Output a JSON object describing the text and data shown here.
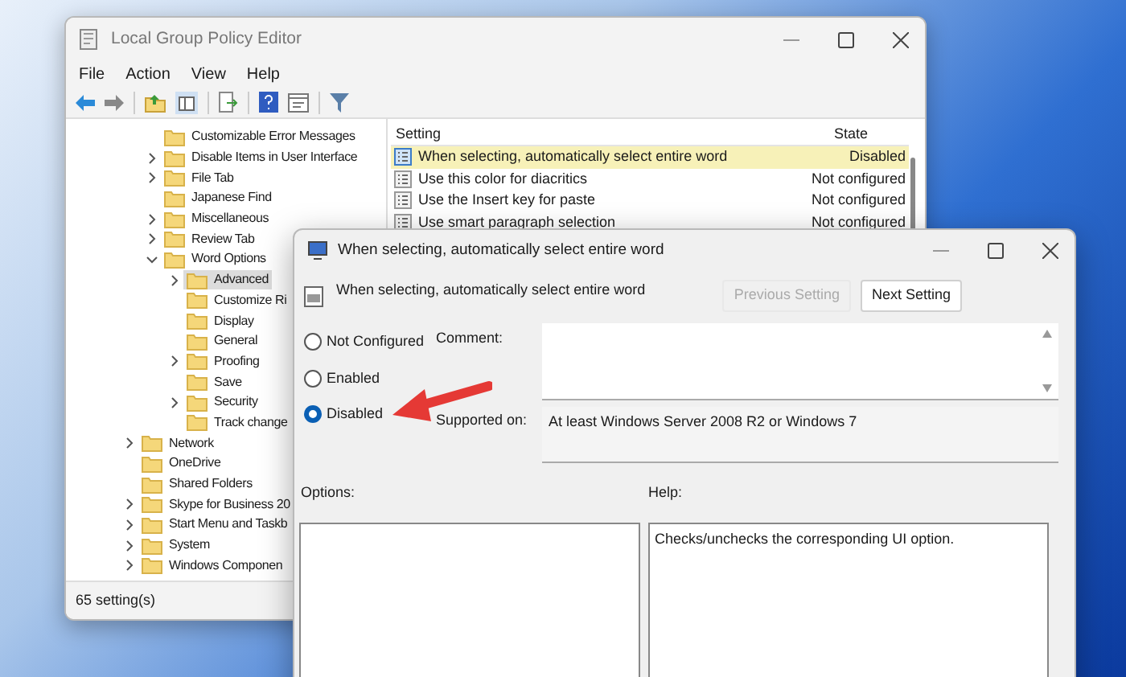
{
  "main_window": {
    "title": "Local Group Policy Editor",
    "menu": [
      "File",
      "Action",
      "View",
      "Help"
    ],
    "tree": [
      {
        "children": [
          {
            "label": "Customizable Error Messages",
            "expandable": false,
            "selected": false
          },
          {
            "label": "Disable Items in User Interface",
            "expandable": true,
            "selected": false
          },
          {
            "label": "File Tab",
            "expandable": true,
            "selected": false
          },
          {
            "label": "Japanese Find",
            "expandable": false,
            "selected": false
          },
          {
            "label": "Miscellaneous",
            "expandable": true,
            "selected": false
          },
          {
            "label": "Review Tab",
            "expandable": true,
            "selected": false
          },
          {
            "label": "Word Options",
            "expandable": true,
            "expanded": true,
            "selected": false,
            "children": [
              {
                "label": "Advanced",
                "expandable": true,
                "selected": true
              },
              {
                "label": "Customize Ri",
                "expandable": false,
                "selected": false
              },
              {
                "label": "Display",
                "expandable": false,
                "selected": false
              },
              {
                "label": "General",
                "expandable": false,
                "selected": false
              },
              {
                "label": "Proofing",
                "expandable": true,
                "selected": false
              },
              {
                "label": "Save",
                "expandable": false,
                "selected": false
              },
              {
                "label": "Security",
                "expandable": true,
                "selected": false
              },
              {
                "label": "Track change",
                "expandable": false,
                "selected": false
              }
            ]
          }
        ]
      },
      {
        "label": "Network",
        "expandable": true,
        "selected": false
      },
      {
        "label": "OneDrive",
        "expandable": false,
        "selected": false
      },
      {
        "label": "Shared Folders",
        "expandable": false,
        "selected": false
      },
      {
        "label": "Skype for Business 20",
        "expandable": true,
        "selected": false
      },
      {
        "label": "Start Menu and Taskb",
        "expandable": true,
        "selected": false
      },
      {
        "label": "System",
        "expandable": true,
        "selected": false
      },
      {
        "label": "Windows Componen",
        "expandable": true,
        "selected": false
      }
    ],
    "table": {
      "columns": [
        "Setting",
        "State"
      ],
      "rows": [
        {
          "setting": "When selecting, automatically select entire word",
          "state": "Disabled",
          "selected": true
        },
        {
          "setting": "Use this color for diacritics",
          "state": "Not configured",
          "selected": false
        },
        {
          "setting": "Use the Insert key for paste",
          "state": "Not configured",
          "selected": false
        },
        {
          "setting": "Use smart paragraph selection",
          "state": "Not configured",
          "selected": false
        }
      ]
    },
    "status_bar": "65 setting(s)"
  },
  "dialog": {
    "title": "When selecting, automatically select entire word",
    "heading": "When selecting, automatically select entire word",
    "buttons": [
      {
        "label": "Previous Setting",
        "disabled": true
      },
      {
        "label": "Next Setting",
        "disabled": false
      }
    ],
    "radios": [
      {
        "label": "Not Configured",
        "selected": false
      },
      {
        "label": "Enabled",
        "selected": false
      },
      {
        "label": "Disabled",
        "selected": true
      }
    ],
    "comment_label": "Comment:",
    "supported_label": "Supported on:",
    "supported_value": "At least Windows Server 2008 R2 or Windows 7",
    "options_label": "Options:",
    "help_label": "Help:",
    "help_text": "Checks/unchecks the corresponding UI option."
  }
}
